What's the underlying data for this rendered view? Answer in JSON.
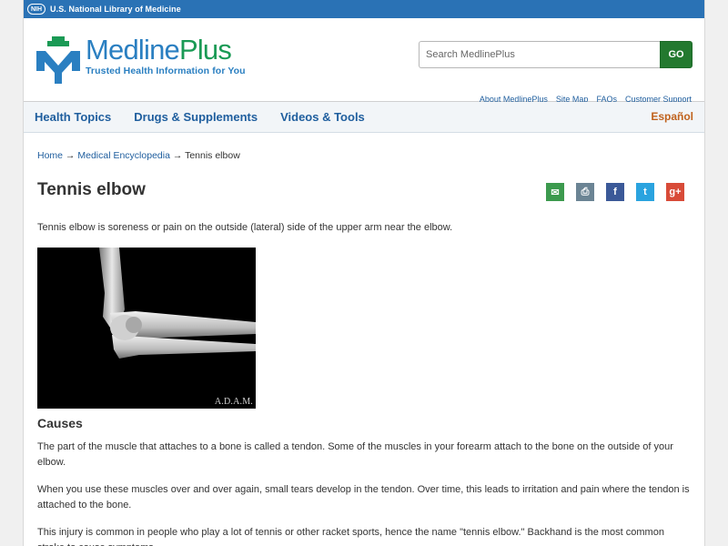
{
  "nlm_bar": {
    "badge": "NIH",
    "text": "U.S. National Library of Medicine"
  },
  "logo": {
    "name_main": "Medline",
    "name_plus": "Plus",
    "tagline": "Trusted Health Information for You"
  },
  "search": {
    "placeholder": "Search MedlinePlus",
    "go_label": "GO"
  },
  "util_links": [
    "About MedlinePlus",
    "Site Map",
    "FAQs",
    "Customer Support"
  ],
  "nav": {
    "items": [
      "Health Topics",
      "Drugs & Supplements",
      "Videos & Tools"
    ],
    "espanol": "Español"
  },
  "breadcrumb": {
    "home": "Home",
    "sep": " → ",
    "encyclopedia": "Medical Encyclopedia",
    "current": "Tennis elbow"
  },
  "page": {
    "title": "Tennis elbow",
    "intro": "Tennis elbow is soreness or pain on the outside (lateral) side of the upper arm near the elbow.",
    "image_credit": "A.D.A.M.",
    "section_title": "Causes",
    "paragraphs": [
      "The part of the muscle that attaches to a bone is called a tendon. Some of the muscles in your forearm attach to the bone on the outside of your elbow.",
      "When you use these muscles over and over again, small tears develop in the tendon. Over time, this leads to irritation and pain where the tendon is attached to the bone.",
      "This injury is common in people who play a lot of tennis or other racket sports, hence the name \"tennis elbow.\" Backhand is the most common stroke to cause symptoms."
    ]
  },
  "share": {
    "email": "✉",
    "print": "⎙",
    "facebook": "f",
    "twitter": "t",
    "googleplus": "g+"
  },
  "colors": {
    "nlm_blue": "#2a72b5",
    "logo_blue": "#2a7fc1",
    "logo_green": "#1a9a55",
    "go_green": "#23792f",
    "link_blue": "#1f5e9e",
    "espanol_orange": "#c0621d"
  }
}
